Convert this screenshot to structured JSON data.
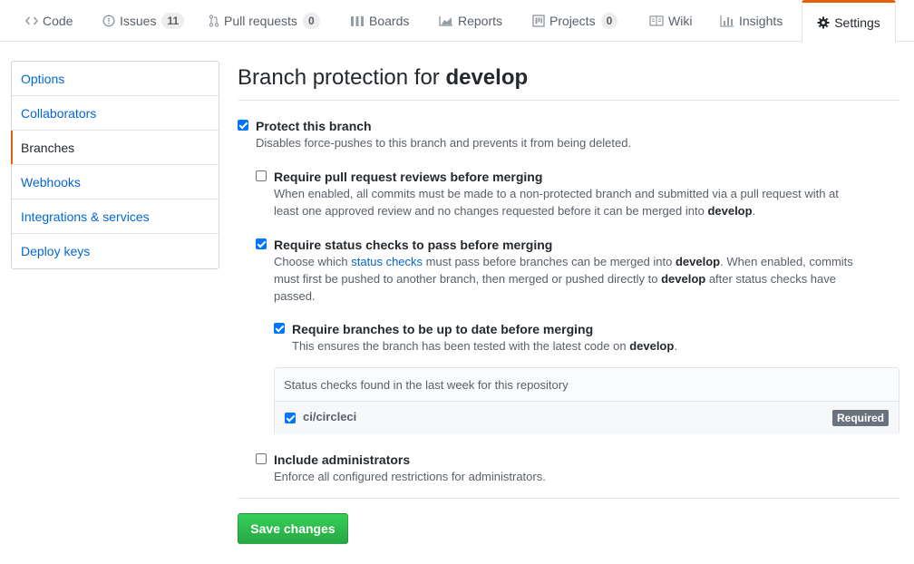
{
  "tabs": [
    {
      "label": "Code",
      "icon": "code-icon"
    },
    {
      "label": "Issues",
      "icon": "issue-icon",
      "count": "11"
    },
    {
      "label": "Pull requests",
      "icon": "pull-request-icon",
      "count": "0"
    },
    {
      "label": "Boards",
      "icon": "boards-icon"
    },
    {
      "label": "Reports",
      "icon": "reports-icon"
    },
    {
      "label": "Projects",
      "icon": "project-icon",
      "count": "0"
    },
    {
      "label": "Wiki",
      "icon": "book-icon"
    },
    {
      "label": "Insights",
      "icon": "graph-icon"
    },
    {
      "label": "Settings",
      "icon": "gear-icon",
      "selected": true
    }
  ],
  "menu": [
    "Options",
    "Collaborators",
    "Branches",
    "Webhooks",
    "Integrations & services",
    "Deploy keys"
  ],
  "page": {
    "title_prefix": "Branch protection for ",
    "branch": "develop"
  },
  "protect": {
    "label": "Protect this branch",
    "note": "Disables force-pushes to this branch and prevents it from being deleted.",
    "checked": true
  },
  "reviews": {
    "label": "Require pull request reviews before merging",
    "note_1": "When enabled, all commits must be made to a non-protected branch and submitted via a pull request with at",
    "note_2": "least one approved review and no changes requested before it can be merged into ",
    "note_branch": "develop",
    "note_end": ".",
    "checked": false
  },
  "status": {
    "label": "Require status checks to pass before merging",
    "note_a": "Choose which ",
    "link": "status checks",
    "note_b": " must pass before branches can be merged into ",
    "branch": "develop",
    "note_c": ". When enabled, commits",
    "note_d": "must first be pushed to another branch, then merged or pushed directly to ",
    "note_e": " after status checks have",
    "note_f": "passed.",
    "checked": true
  },
  "uptodate": {
    "label": "Require branches to be up to date before merging",
    "note": "This ensures the branch has been tested with the latest code on ",
    "branch": "develop",
    "note_end": ".",
    "checked": true
  },
  "checks": {
    "header": "Status checks found in the last week for this repository",
    "items": [
      {
        "name": "ci/circleci",
        "badge": "Required",
        "checked": true
      }
    ]
  },
  "admins": {
    "label": "Include administrators",
    "note": "Enforce all configured restrictions for administrators.",
    "checked": false
  },
  "save_label": "Save changes",
  "colors": {
    "accent": "#e36209",
    "link": "#0366d6",
    "save": "#28a745"
  }
}
